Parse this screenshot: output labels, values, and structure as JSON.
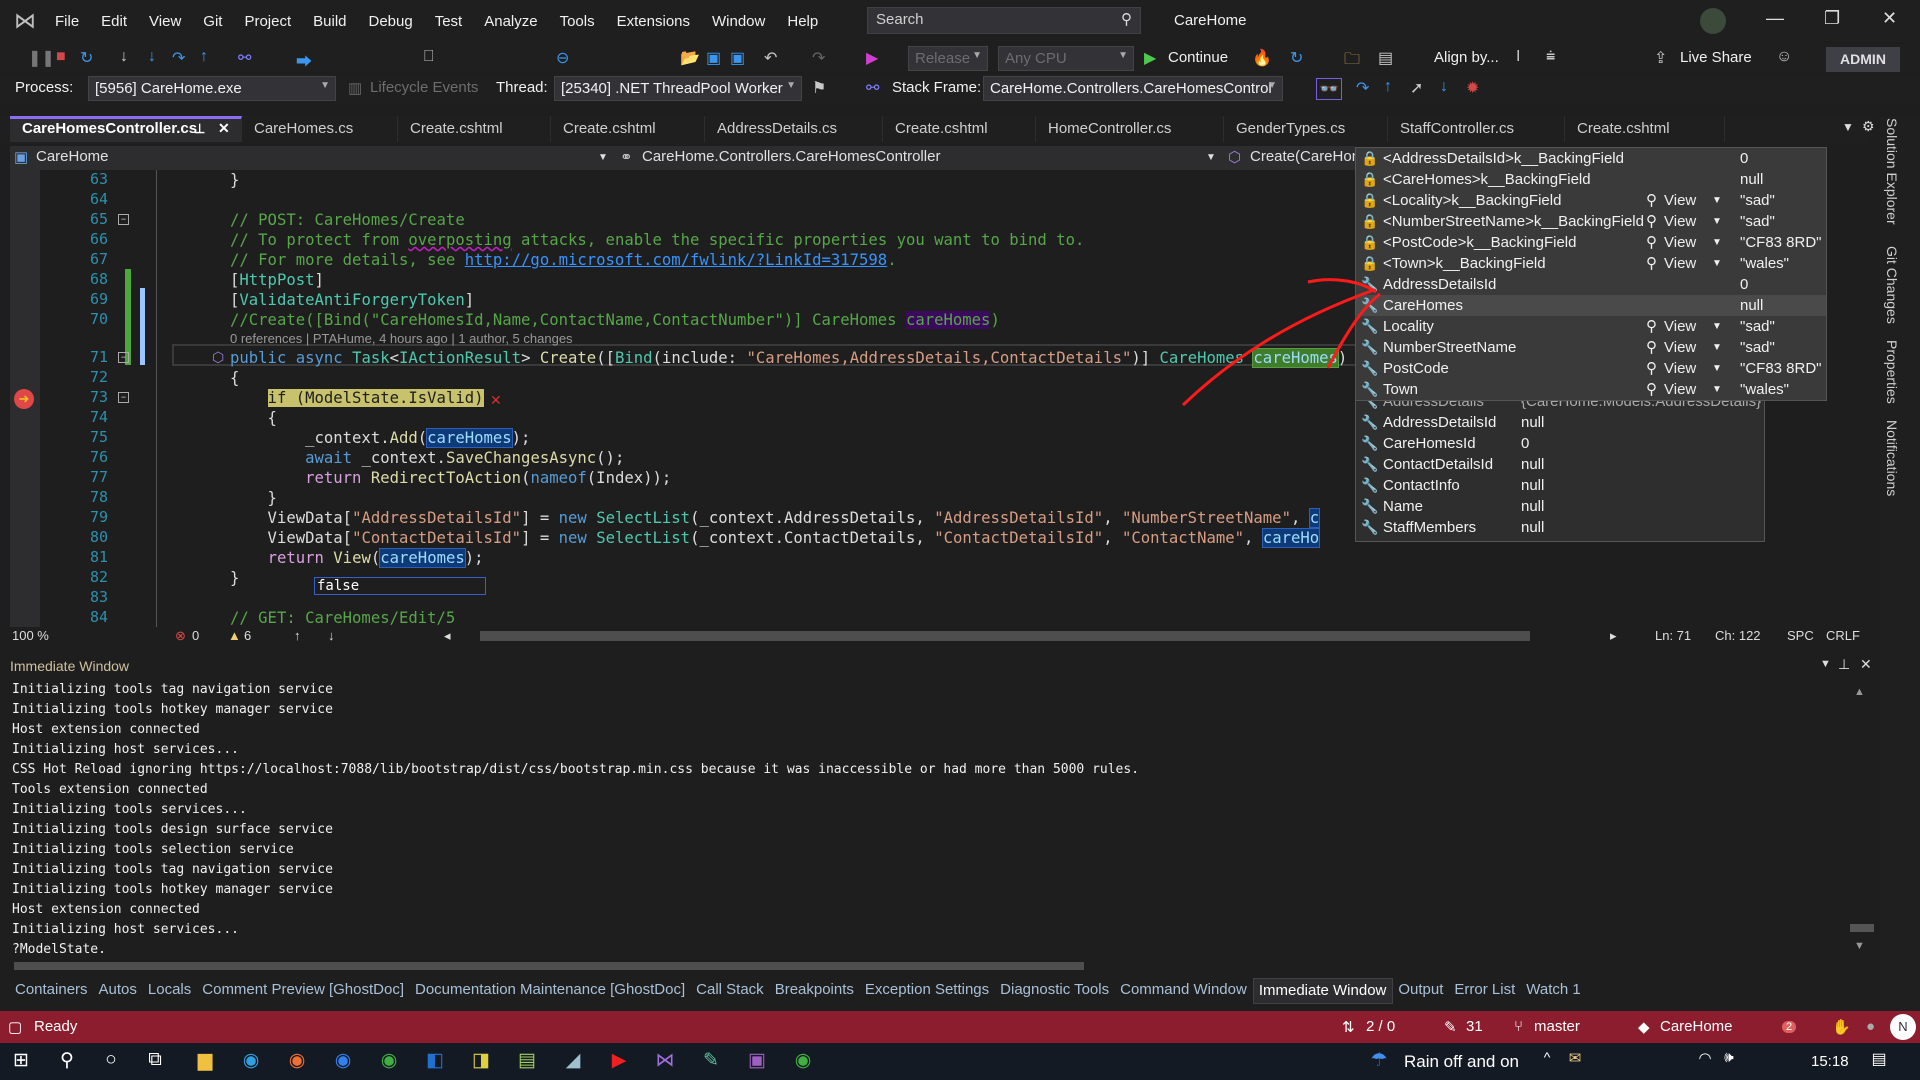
{
  "window": {
    "title": "CareHome",
    "search_placeholder": "Search",
    "admin": "ADMIN"
  },
  "menu": [
    "File",
    "Edit",
    "View",
    "Git",
    "Project",
    "Build",
    "Debug",
    "Test",
    "Analyze",
    "Tools",
    "Extensions",
    "Window",
    "Help"
  ],
  "toolbar": {
    "configuration": "Release",
    "platform": "Any CPU",
    "continue": "Continue",
    "align": "Align by...",
    "live_share": "Live Share"
  },
  "debug_location": {
    "process_label": "Process:",
    "process": "[5956] CareHome.exe",
    "lifecycle": "Lifecycle Events",
    "thread_label": "Thread:",
    "thread": "[25340] .NET ThreadPool Worker",
    "stack_frame_label": "Stack Frame:",
    "stack_frame": "CareHome.Controllers.CareHomesControl"
  },
  "tabs": [
    "CareHomesController.cs",
    "CareHomes.cs",
    "Create.cshtml",
    "Create.cshtml",
    "AddressDetails.cs",
    "Create.cshtml",
    "HomeController.cs",
    "GenderTypes.cs",
    "StaffController.cs",
    "Create.cshtml"
  ],
  "navbar": {
    "project": "CareHome",
    "class": "CareHome.Controllers.CareHomesController",
    "member": "Create(CareHom"
  },
  "code": {
    "codelens": "0 references | PTAHume, 4 hours ago | 1 author, 5 changes",
    "lines": [
      {
        "n": "63",
        "tk": [
          [
            "}",
            "p"
          ]
        ]
      },
      {
        "n": "64",
        "tk": []
      },
      {
        "n": "65",
        "tk": [
          [
            "// POST: CareHomes/Create",
            "c"
          ]
        ]
      },
      {
        "n": "66",
        "tk": [
          [
            "// To protect from ",
            "c"
          ],
          [
            "overposting",
            "c sq"
          ],
          [
            " attacks, enable the specific properties you want to bind to.",
            "c"
          ]
        ]
      },
      {
        "n": "67",
        "tk": [
          [
            "// For more details, see ",
            "c"
          ],
          [
            "http://go.microsoft.com/fwlink/?LinkId=317598",
            "u"
          ],
          [
            ".",
            "c"
          ]
        ]
      },
      {
        "n": "68",
        "tk": [
          [
            "[",
            "p"
          ],
          [
            "HttpPost",
            "t"
          ],
          [
            "]",
            "p"
          ]
        ]
      },
      {
        "n": "69",
        "tk": [
          [
            "[",
            "p"
          ],
          [
            "ValidateAntiForgeryToken",
            "t"
          ],
          [
            "]",
            "p"
          ]
        ]
      },
      {
        "n": "70",
        "tk": [
          [
            "//Create([Bind(\"CareHomesId,Name,ContactName,ContactNumber\")] CareHomes ",
            "c"
          ],
          [
            "careHomes",
            "hlp"
          ],
          [
            ")",
            "c"
          ]
        ]
      },
      {
        "n": "71",
        "tk": [
          [
            "public async ",
            "k"
          ],
          [
            "Task",
            "t"
          ],
          [
            "<",
            "p"
          ],
          [
            "IActionResult",
            "t"
          ],
          [
            "> ",
            "p"
          ],
          [
            "Create",
            "m"
          ],
          [
            "([",
            "p"
          ],
          [
            "Bind",
            "t"
          ],
          [
            "(include: ",
            "p"
          ],
          [
            "\"CareHomes,AddressDetails,ContactDetails\"",
            "s"
          ],
          [
            ")] ",
            "p"
          ],
          [
            "CareHomes",
            "t"
          ],
          [
            " ",
            "p"
          ],
          [
            "careHomes",
            "hlg"
          ],
          [
            ")",
            "p"
          ]
        ]
      },
      {
        "n": "72",
        "tk": [
          [
            "{",
            "p"
          ]
        ]
      },
      {
        "n": "73",
        "tk": [
          [
            "    ",
            "p"
          ],
          [
            "if (ModelState.IsValid)",
            "hly"
          ]
        ]
      },
      {
        "n": "74",
        "tk": [
          [
            "    {",
            "p"
          ]
        ]
      },
      {
        "n": "75",
        "tk": [
          [
            "        _context.",
            "p"
          ],
          [
            "Add",
            "m"
          ],
          [
            "(",
            "p"
          ],
          [
            "careHomes",
            "hlb"
          ],
          [
            ");",
            "p"
          ]
        ]
      },
      {
        "n": "76",
        "tk": [
          [
            "        ",
            "p"
          ],
          [
            "await",
            "k"
          ],
          [
            " _context.",
            "p"
          ],
          [
            "SaveChangesAsync",
            "m"
          ],
          [
            "();",
            "p"
          ]
        ]
      },
      {
        "n": "77",
        "tk": [
          [
            "        ",
            "p"
          ],
          [
            "return",
            "ck"
          ],
          [
            " ",
            "p"
          ],
          [
            "RedirectToAction",
            "m"
          ],
          [
            "(",
            "p"
          ],
          [
            "nameof",
            "k"
          ],
          [
            "(Index));",
            "p"
          ]
        ]
      },
      {
        "n": "78",
        "tk": [
          [
            "    }",
            "p"
          ]
        ]
      },
      {
        "n": "79",
        "tk": [
          [
            "    ViewData[",
            "p"
          ],
          [
            "\"AddressDetailsId\"",
            "s"
          ],
          [
            "] = ",
            "p"
          ],
          [
            "new",
            "k"
          ],
          [
            " ",
            "p"
          ],
          [
            "SelectList",
            "t"
          ],
          [
            "(_context.AddressDetails, ",
            "p"
          ],
          [
            "\"AddressDetailsId\"",
            "s"
          ],
          [
            ", ",
            "p"
          ],
          [
            "\"NumberStreetName\"",
            "s"
          ],
          [
            ", ",
            "p"
          ],
          [
            "c",
            "hlb"
          ]
        ]
      },
      {
        "n": "80",
        "tk": [
          [
            "    ViewData[",
            "p"
          ],
          [
            "\"ContactDetailsId\"",
            "s"
          ],
          [
            "] = ",
            "p"
          ],
          [
            "new",
            "k"
          ],
          [
            " ",
            "p"
          ],
          [
            "SelectList",
            "t"
          ],
          [
            "(_context.ContactDetails, ",
            "p"
          ],
          [
            "\"ContactDetailsId\"",
            "s"
          ],
          [
            ", ",
            "p"
          ],
          [
            "\"ContactName\"",
            "s"
          ],
          [
            ", ",
            "p"
          ],
          [
            "careHo",
            "hlb"
          ]
        ]
      },
      {
        "n": "81",
        "tk": [
          [
            "    ",
            "p"
          ],
          [
            "return",
            "ck"
          ],
          [
            " ",
            "p"
          ],
          [
            "View",
            "m"
          ],
          [
            "(",
            "p"
          ],
          [
            "careHomes",
            "hlb"
          ],
          [
            ");",
            "p"
          ]
        ]
      },
      {
        "n": "82",
        "tk": [
          [
            "}",
            "p"
          ]
        ]
      },
      {
        "n": "83",
        "tk": []
      },
      {
        "n": "84",
        "tk": [
          [
            "// GET: CareHomes/Edit/5",
            "c"
          ]
        ]
      }
    ],
    "inline_value": "false"
  },
  "editor_status": {
    "zoom": "100 %",
    "errors": "0",
    "warnings": "6",
    "line": "Ln: 71",
    "col": "Ch: 122",
    "spacing": "SPC",
    "eol": "CRLF"
  },
  "datatip": {
    "rows": [
      {
        "icon": "private-field-icon",
        "name": "<AddressDetailsId>k__BackingField",
        "view": "",
        "value": "0"
      },
      {
        "icon": "private-field-icon",
        "name": "<CareHomes>k__BackingField",
        "view": "",
        "value": "null"
      },
      {
        "icon": "private-field-icon",
        "name": "<Locality>k__BackingField",
        "view": "View",
        "value": "\"sad\""
      },
      {
        "icon": "private-field-icon",
        "name": "<NumberStreetName>k__BackingField",
        "view": "View",
        "value": "\"sad\""
      },
      {
        "icon": "private-field-icon",
        "name": "<PostCode>k__BackingField",
        "view": "View",
        "value": "\"CF83 8RD\""
      },
      {
        "icon": "private-field-icon",
        "name": "<Town>k__BackingField",
        "view": "View",
        "value": "\"wales\""
      },
      {
        "icon": "property-icon",
        "name": "AddressDetailsId",
        "view": "",
        "value": "0"
      },
      {
        "icon": "property-icon",
        "name": "CareHomes",
        "view": "",
        "value": "null"
      },
      {
        "icon": "property-icon",
        "name": "Locality",
        "view": "View",
        "value": "\"sad\""
      },
      {
        "icon": "property-icon",
        "name": "NumberStreetName",
        "view": "View",
        "value": "\"sad\""
      },
      {
        "icon": "property-icon",
        "name": "PostCode",
        "view": "View",
        "value": "\"CF83 8RD\""
      },
      {
        "icon": "property-icon",
        "name": "Town",
        "view": "View",
        "value": "\"wales\""
      }
    ],
    "parent": {
      "name": "AddressDetails",
      "value": "{CareHome.Models.AddressDetails}"
    },
    "parent_rows": [
      {
        "name": "AddressDetailsId",
        "value": "null"
      },
      {
        "name": "CareHomesId",
        "value": "0"
      },
      {
        "name": "ContactDetailsId",
        "value": "null"
      },
      {
        "name": "ContactInfo",
        "value": "null"
      },
      {
        "name": "Name",
        "value": "null"
      },
      {
        "name": "StaffMembers",
        "value": "null"
      }
    ]
  },
  "immediate": {
    "title": "Immediate Window",
    "lines": [
      "Initializing tools tag navigation service",
      "Initializing tools hotkey manager service",
      "Host extension connected",
      "Initializing host services...",
      "CSS Hot Reload ignoring https://localhost:7088/lib/bootstrap/dist/css/bootstrap.min.css because it was inaccessible or had more than 5000 rules.",
      "Tools extension connected",
      "Initializing tools services...",
      "Initializing tools design surface service",
      "Initializing tools selection service",
      "Initializing tools tag navigation service",
      "Initializing tools hotkey manager service",
      "Host extension connected",
      "Initializing host services...",
      "?ModelState."
    ]
  },
  "bottom_tabs": [
    "Containers",
    "Autos",
    "Locals",
    "Comment Preview [GhostDoc]",
    "Documentation Maintenance [GhostDoc]",
    "Call Stack",
    "Breakpoints",
    "Exception Settings",
    "Diagnostic Tools",
    "Command Window",
    "Immediate Window",
    "Output",
    "Error List",
    "Watch 1"
  ],
  "bottom_active": "Immediate Window",
  "right_panels": [
    "Solution Explorer",
    "Git Changes",
    "Properties",
    "Notifications"
  ],
  "statusbar": {
    "ready": "Ready",
    "sync": "2 / 0",
    "edits": "31",
    "branch": "master",
    "repo": "CareHome",
    "notif_count": "2",
    "avatar": "N"
  },
  "taskbar": {
    "weather": "Rain off and on",
    "time": "15:18"
  },
  "colors": {
    "status_bar": "#8b1d2e",
    "active_tab_accent": "#8a6df0",
    "annotation": "#ff1a1a"
  }
}
